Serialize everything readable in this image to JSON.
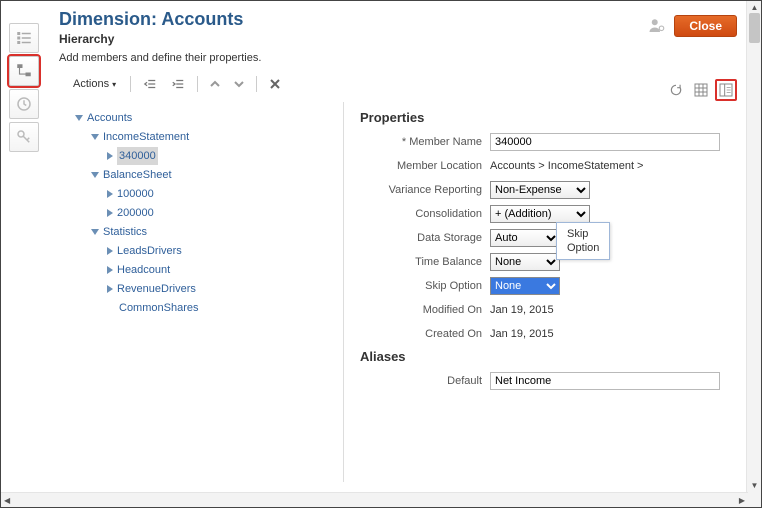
{
  "header": {
    "title": "Dimension: Accounts",
    "subtitle": "Hierarchy",
    "helper": "Add members and define their properties.",
    "close_label": "Close"
  },
  "toolbar": {
    "actions_label": "Actions"
  },
  "tree": {
    "root": "Accounts",
    "n_income": "IncomeStatement",
    "n_340000": "340000",
    "n_balance": "BalanceSheet",
    "n_100000": "100000",
    "n_200000": "200000",
    "n_stats": "Statistics",
    "n_leads": "LeadsDrivers",
    "n_head": "Headcount",
    "n_rev": "RevenueDrivers",
    "n_common": "CommonShares"
  },
  "props": {
    "section1": "Properties",
    "member_name_label": "Member Name",
    "member_name_value": "340000",
    "location_label": "Member Location",
    "location_value": "Accounts > IncomeStatement >",
    "variance_label": "Variance Reporting",
    "variance_value": "Non-Expense",
    "consolidation_label": "Consolidation",
    "consolidation_value": "+ (Addition)",
    "storage_label": "Data Storage",
    "storage_value": "Auto",
    "timebal_label": "Time Balance",
    "timebal_value": "None",
    "skip_label": "Skip Option",
    "skip_value": "None",
    "modified_label": "Modified On",
    "modified_value": "Jan 19, 2015",
    "created_label": "Created On",
    "created_value": "Jan 19, 2015",
    "section2": "Aliases",
    "default_label": "Default",
    "default_value": "Net Income"
  },
  "tooltip": {
    "line1": "Skip",
    "line2": "Option"
  }
}
